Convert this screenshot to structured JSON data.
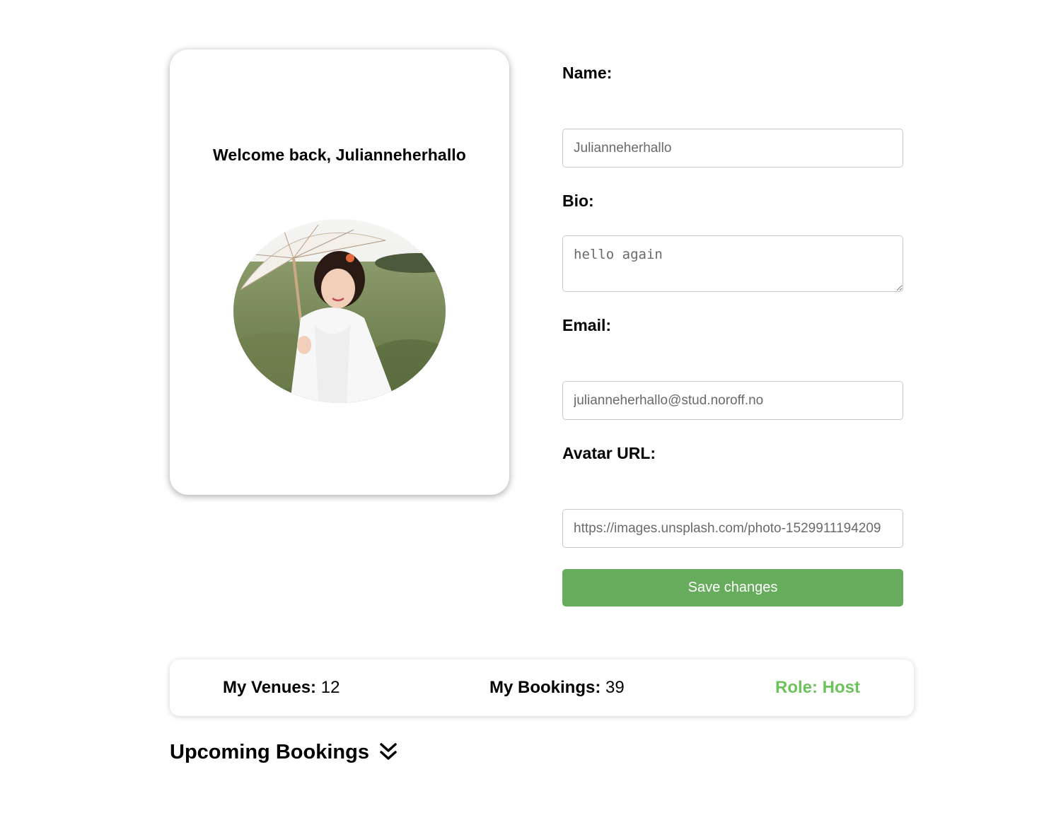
{
  "profile": {
    "welcome_text": "Welcome back, Julianneherhallo",
    "avatar_alt": "avatar-photo"
  },
  "form": {
    "name_label": "Name:",
    "name_value": "Julianneherhallo",
    "bio_label": "Bio:",
    "bio_value": "hello again",
    "email_label": "Email:",
    "email_value": "julianneherhallo@stud.noroff.no",
    "avatar_label": "Avatar URL:",
    "avatar_value": "https://images.unsplash.com/photo-1529911194209",
    "save_label": "Save changes"
  },
  "stats": {
    "venues_label": "My Venues:",
    "venues_value": "12",
    "bookings_label": "My Bookings:",
    "bookings_value": "39",
    "role_text": "Role: Host"
  },
  "upcoming": {
    "title": "Upcoming Bookings",
    "icon": "chevron-double-down-icon"
  },
  "colors": {
    "accent_green": "#67ac5c",
    "role_green": "#6cc35c"
  }
}
